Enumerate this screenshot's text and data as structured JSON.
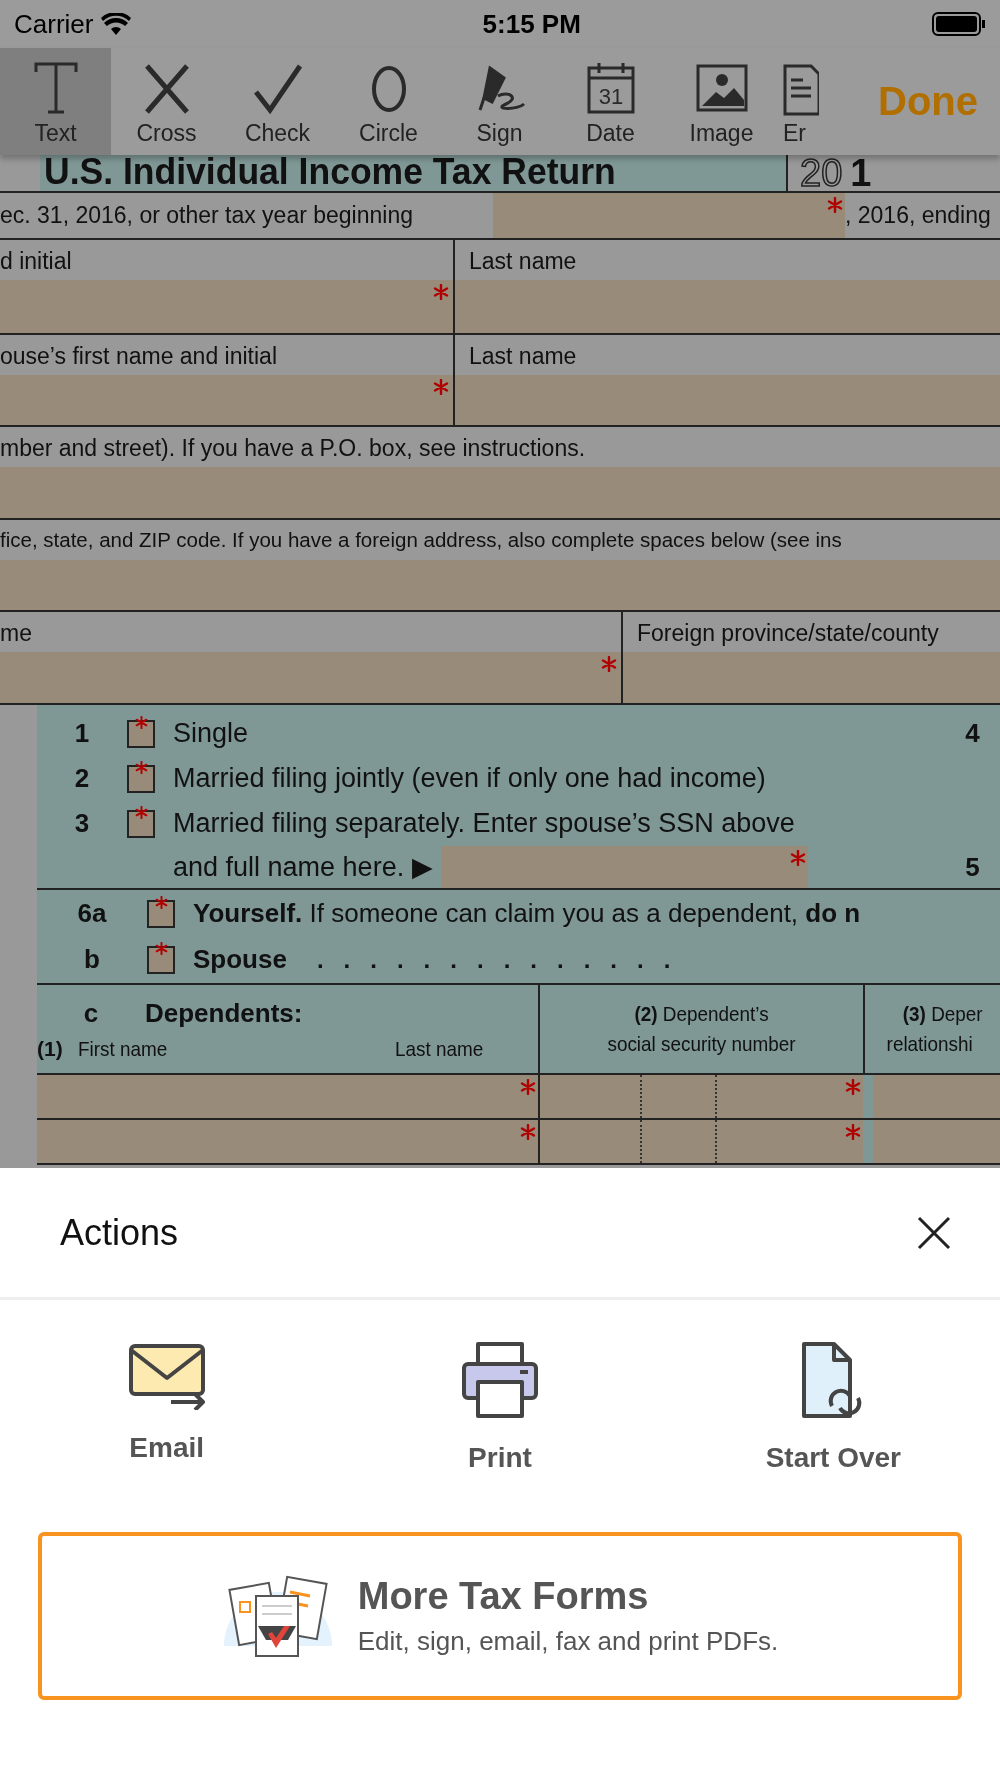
{
  "status_bar": {
    "carrier": "Carrier",
    "time": "5:15 PM"
  },
  "toolbar": {
    "tools": [
      {
        "label": "Text",
        "kind": "text",
        "selected": true
      },
      {
        "label": "Cross",
        "kind": "cross",
        "selected": false
      },
      {
        "label": "Check",
        "kind": "check",
        "selected": false
      },
      {
        "label": "Circle",
        "kind": "circle",
        "selected": false
      },
      {
        "label": "Sign",
        "kind": "sign",
        "selected": false
      },
      {
        "label": "Date",
        "kind": "date",
        "icon_text": "31",
        "selected": false
      },
      {
        "label": "Image",
        "kind": "image",
        "selected": false
      },
      {
        "label": "Er",
        "kind": "document",
        "selected": false
      }
    ],
    "done": "Done"
  },
  "form": {
    "title": "U.S. Individual Income Tax Return",
    "year_outline": "20",
    "year_bold": "1",
    "tax_year_row": {
      "lead": "ec. 31, 2016, or other tax year beginning",
      "trail": ", 2016, ending",
      "required": true
    },
    "name_rows": [
      {
        "left_label": "d initial",
        "right_label": "Last name",
        "required": true
      },
      {
        "left_label": "ouse’s first name and initial",
        "right_label": "Last name",
        "required": true
      }
    ],
    "address_rows": [
      {
        "label": "mber and street). If you have a P.O. box, see instructions."
      },
      {
        "label": "fice, state, and ZIP code. If you have a foreign address, also complete spaces below (see ins"
      }
    ],
    "foreign_row": {
      "left_label": "me",
      "right_label": "Foreign province/state/county",
      "required": true
    },
    "filing_status": [
      {
        "number": "1",
        "text": "Single",
        "side": "4",
        "checked": false
      },
      {
        "number": "2",
        "text": "Married filing jointly (even if only one had income)",
        "checked": false
      },
      {
        "number": "3",
        "text": "Married filing separately. Enter spouse’s SSN above",
        "continuation": "and full name here. ▶",
        "side": "5",
        "checked": false
      }
    ],
    "exemptions": [
      {
        "number": "6a",
        "text": "**Yourself.** If someone can claim you as a dependent, **do n**",
        "checked": false
      },
      {
        "number": "b",
        "text": "**Spouse**",
        "dots": ".   .   .   .   .   .   .   .   .   .   .   .   .   .",
        "checked": false
      }
    ],
    "dependents": {
      "letter": "c",
      "title": "Dependents:",
      "col1_number": "(1)",
      "col1_first": "First name",
      "col1_last": "Last name",
      "col2_line1": "**(2)** Dependent’s",
      "col2_line2": "social security number",
      "col3_line1": "**(3)** Deper",
      "col3_line2": "relationshi",
      "rows": [
        {
          "required": true
        },
        {
          "required": true
        }
      ]
    }
  },
  "sheet": {
    "title": "Actions",
    "actions": [
      {
        "label": "Email",
        "kind": "email"
      },
      {
        "label": "Print",
        "kind": "print"
      },
      {
        "label": "Start Over",
        "kind": "start_over"
      }
    ],
    "promo": {
      "title": "More Tax Forms",
      "subtitle": "Edit, sign, email, fax and print PDFs."
    }
  }
}
